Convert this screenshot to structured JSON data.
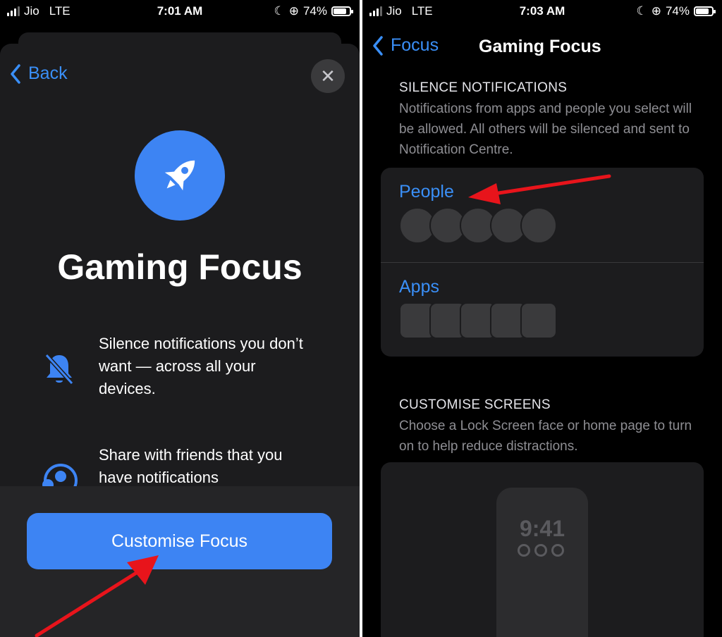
{
  "left_screen": {
    "status": {
      "carrier": "Jio",
      "network": "LTE",
      "time": "7:01 AM",
      "battery": "74%"
    },
    "back_label": "Back",
    "title": "Gaming Focus",
    "features": [
      {
        "icon": "bell-slash-icon",
        "text": "Silence notifications you don’t want — across all your devices."
      },
      {
        "icon": "person-share-icon",
        "text": "Share with friends that you have notifications"
      }
    ],
    "primary_button": "Customise Focus"
  },
  "right_screen": {
    "status": {
      "carrier": "Jio",
      "network": "LTE",
      "time": "7:03 AM",
      "battery": "74%"
    },
    "nav_back": "Focus",
    "nav_title": "Gaming Focus",
    "silence": {
      "title": "SILENCE NOTIFICATIONS",
      "desc": "Notifications from apps and people you select will be allowed. All others will be silenced and sent to Notification Centre.",
      "people_label": "People",
      "apps_label": "Apps"
    },
    "customise": {
      "title": "CUSTOMISE SCREENS",
      "desc": "Choose a Lock Screen face or home page to turn on to help reduce distractions.",
      "lock_time": "9:41"
    }
  },
  "colors": {
    "accent": "#3a8ff7",
    "button": "#3d84f3",
    "annotation_arrow": "#e8141b"
  }
}
